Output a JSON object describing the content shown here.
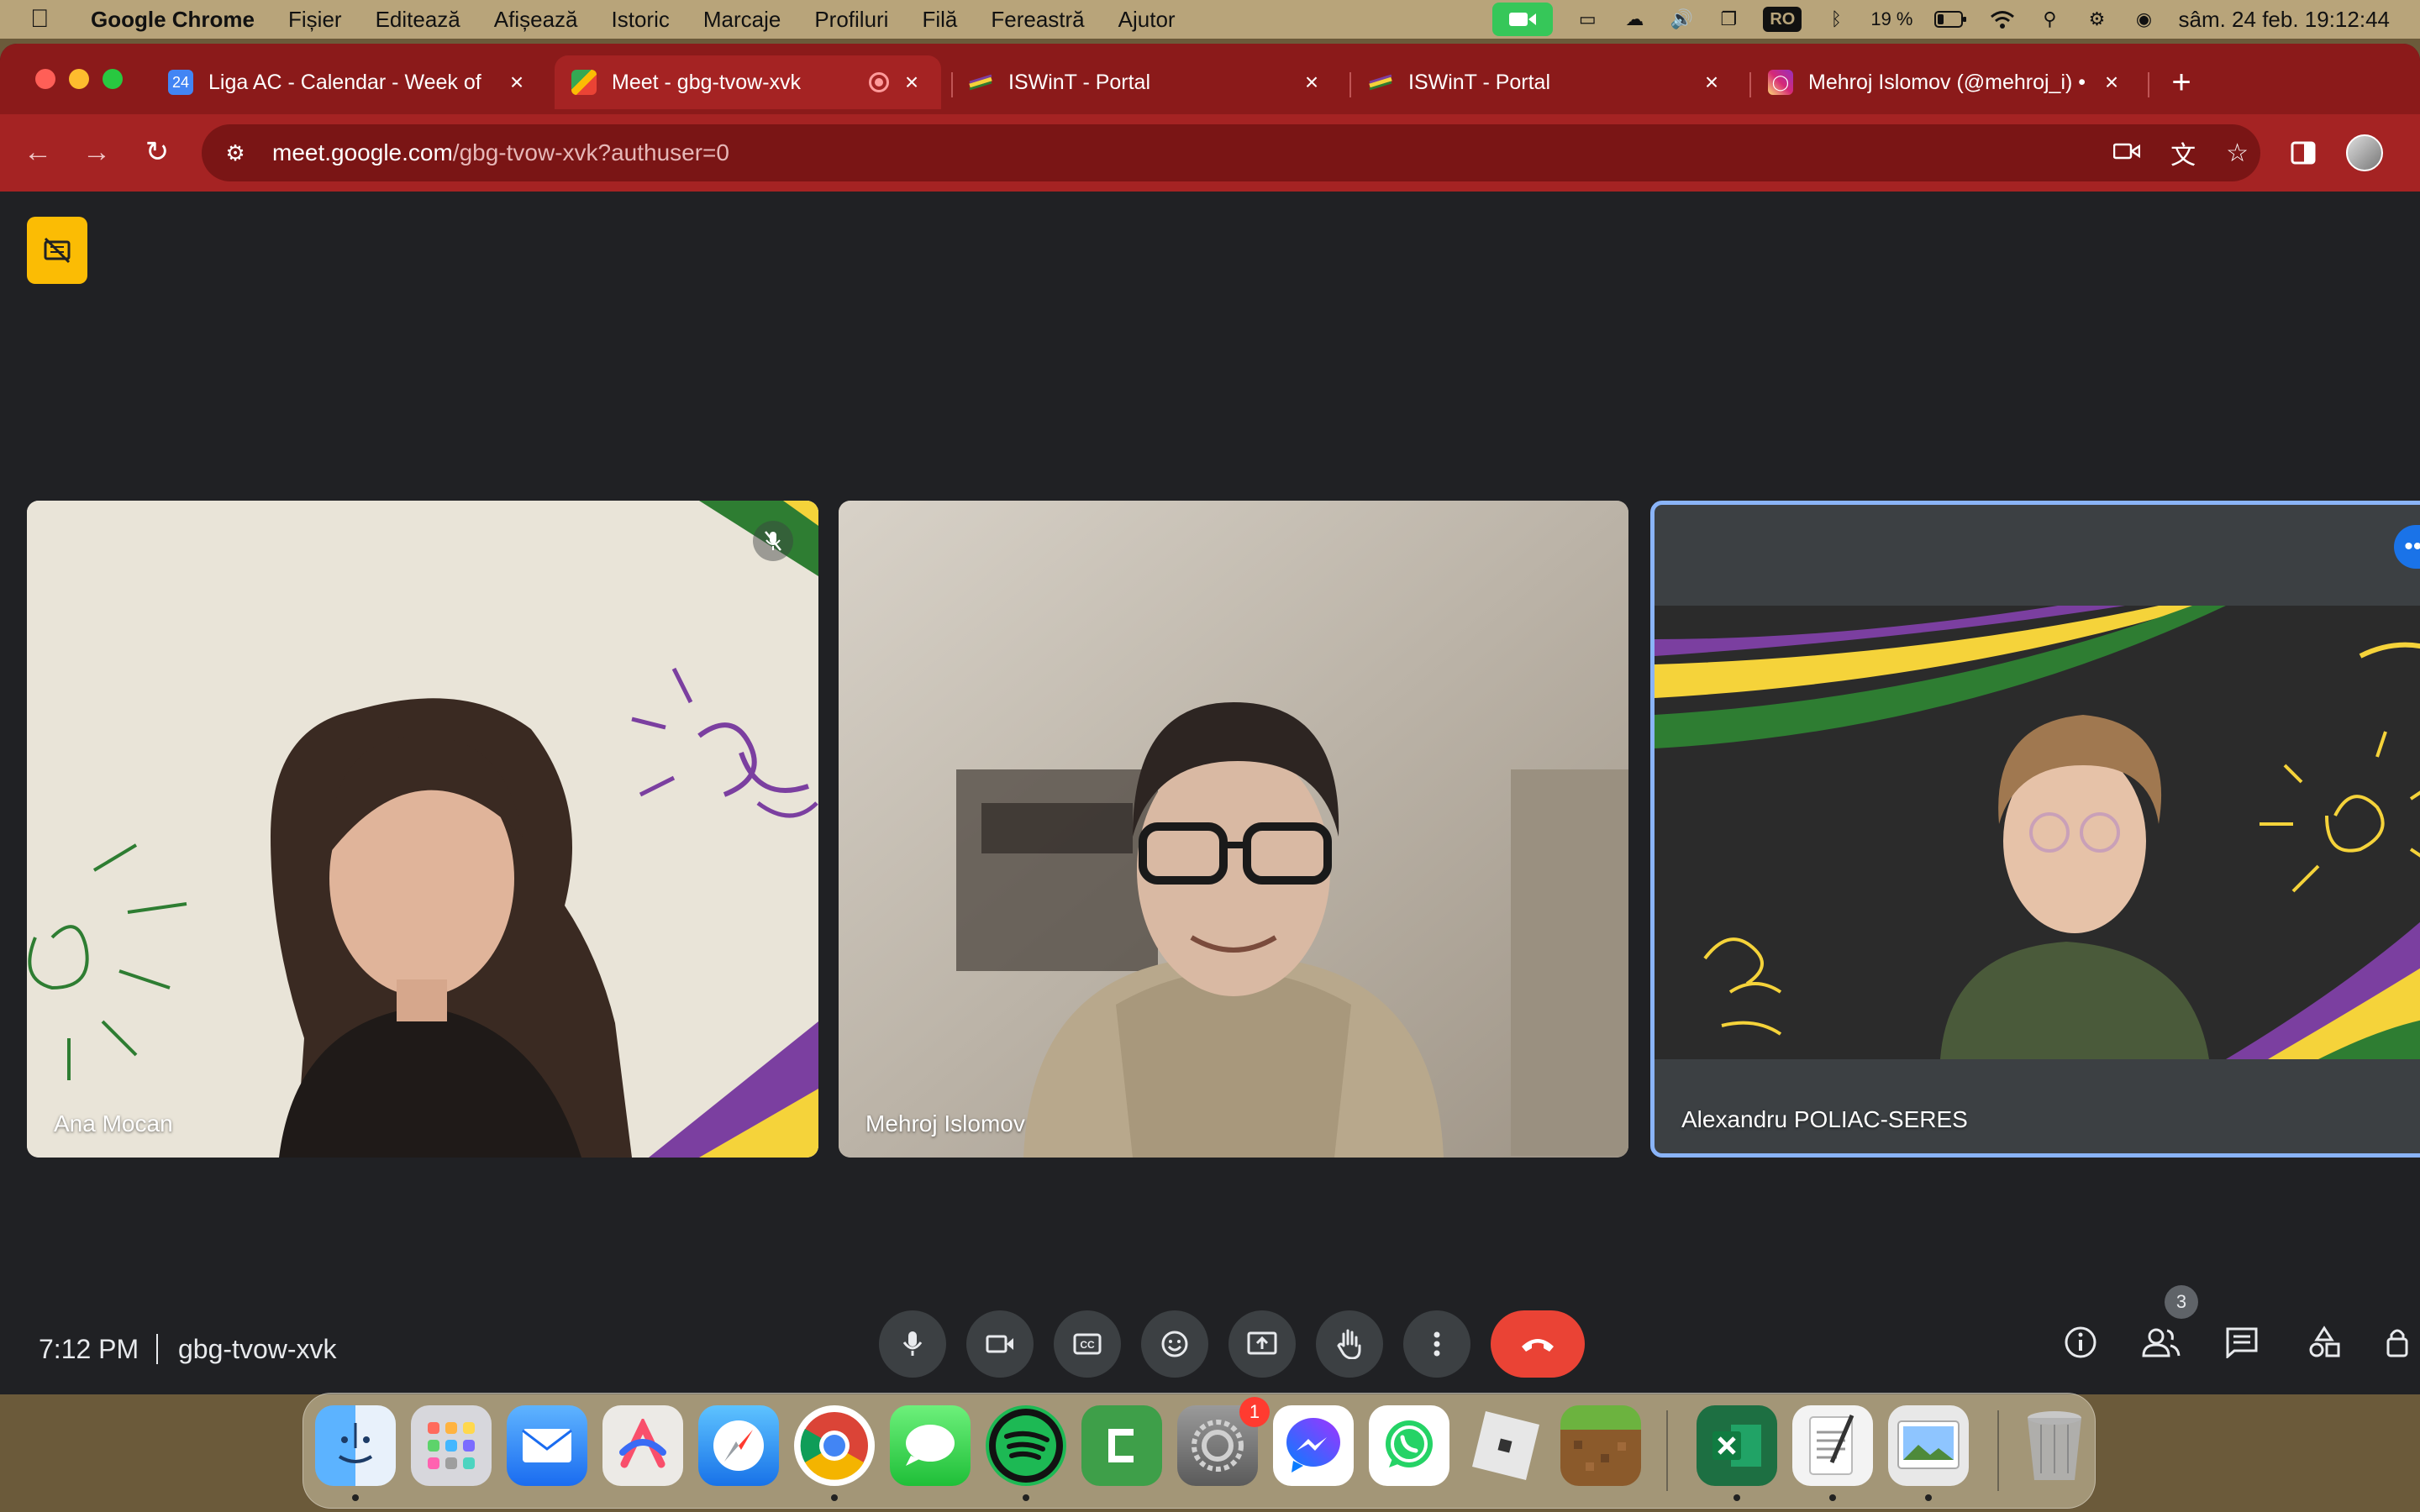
{
  "menubar": {
    "app_name": "Google Chrome",
    "menus": [
      "Fișier",
      "Editează",
      "Afișează",
      "Istoric",
      "Marcaje",
      "Profiluri",
      "Filă",
      "Fereastră",
      "Ajutor"
    ],
    "input_source": "RO",
    "battery": "19 %",
    "datetime": "sâm. 24 feb.  19:12:44"
  },
  "tabs": [
    {
      "title": "Liga AC - Calendar - Week of",
      "favicon": "calendar-icon",
      "favicon_text": "24",
      "active": false
    },
    {
      "title": "Meet - gbg-tvow-xvk",
      "favicon": "meet-icon",
      "active": true
    },
    {
      "title": "ISWinT - Portal",
      "favicon": "iswint-icon",
      "active": false
    },
    {
      "title": "ISWinT - Portal",
      "favicon": "iswint-icon",
      "active": false
    },
    {
      "title": "Mehroj Islomov (@mehroj_i) •",
      "favicon": "instagram-icon",
      "active": false
    }
  ],
  "omnibox": {
    "host": "meet.google.com",
    "path": "/gbg-tvow-xvk?authuser=0"
  },
  "participants": [
    {
      "name": "Ana Mocan",
      "muted": true
    },
    {
      "name": "Mehroj Islomov",
      "muted": false
    },
    {
      "name": "Alexandru POLIAC-SERES",
      "muted": false,
      "speaking_frame": true
    }
  ],
  "meeting": {
    "time": "7:12 PM",
    "code": "gbg-tvow-xvk",
    "participant_count": "3"
  },
  "dock": {
    "apps": [
      "Finder",
      "Launchpad",
      "Mail",
      "Arc",
      "Safari",
      "Chrome",
      "Messages",
      "Spotify",
      "Camtasia",
      "System Settings",
      "Messenger",
      "WhatsApp",
      "Roblox",
      "Minecraft",
      "Excel",
      "TextEdit",
      "Preview",
      "Trash"
    ],
    "settings_badge": "1"
  },
  "colors": {
    "tab_strip": "#8b1a1a",
    "toolbar": "#a52323",
    "meet_bg": "#202124",
    "end_call": "#ea4335",
    "active_speaker_border": "#8ab4f8",
    "no_video_badge": "#fbbc04"
  }
}
